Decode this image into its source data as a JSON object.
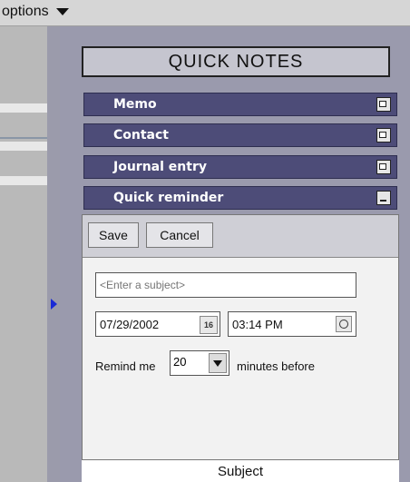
{
  "toolbar": {
    "options_label": "options"
  },
  "panel": {
    "title": "QUICK NOTES",
    "sections": [
      {
        "label": "Memo",
        "state": "collapsed"
      },
      {
        "label": "Contact",
        "state": "collapsed"
      },
      {
        "label": "Journal entry",
        "state": "collapsed"
      },
      {
        "label": "Quick reminder",
        "state": "expanded"
      }
    ]
  },
  "reminder": {
    "save_label": "Save",
    "cancel_label": "Cancel",
    "subject_placeholder": "<Enter a subject>",
    "date_value": "07/29/2002",
    "calendar_icon_text": "16",
    "time_value": "03:14 PM",
    "remind_prefix": "Remind me",
    "minutes_value": "20",
    "remind_suffix": "minutes before"
  },
  "footer": {
    "label": "Subject"
  },
  "colors": {
    "section_bg": "#4d4c78",
    "panel_bg": "#9a9aad",
    "expand_arrow": "#1a2ad6"
  }
}
